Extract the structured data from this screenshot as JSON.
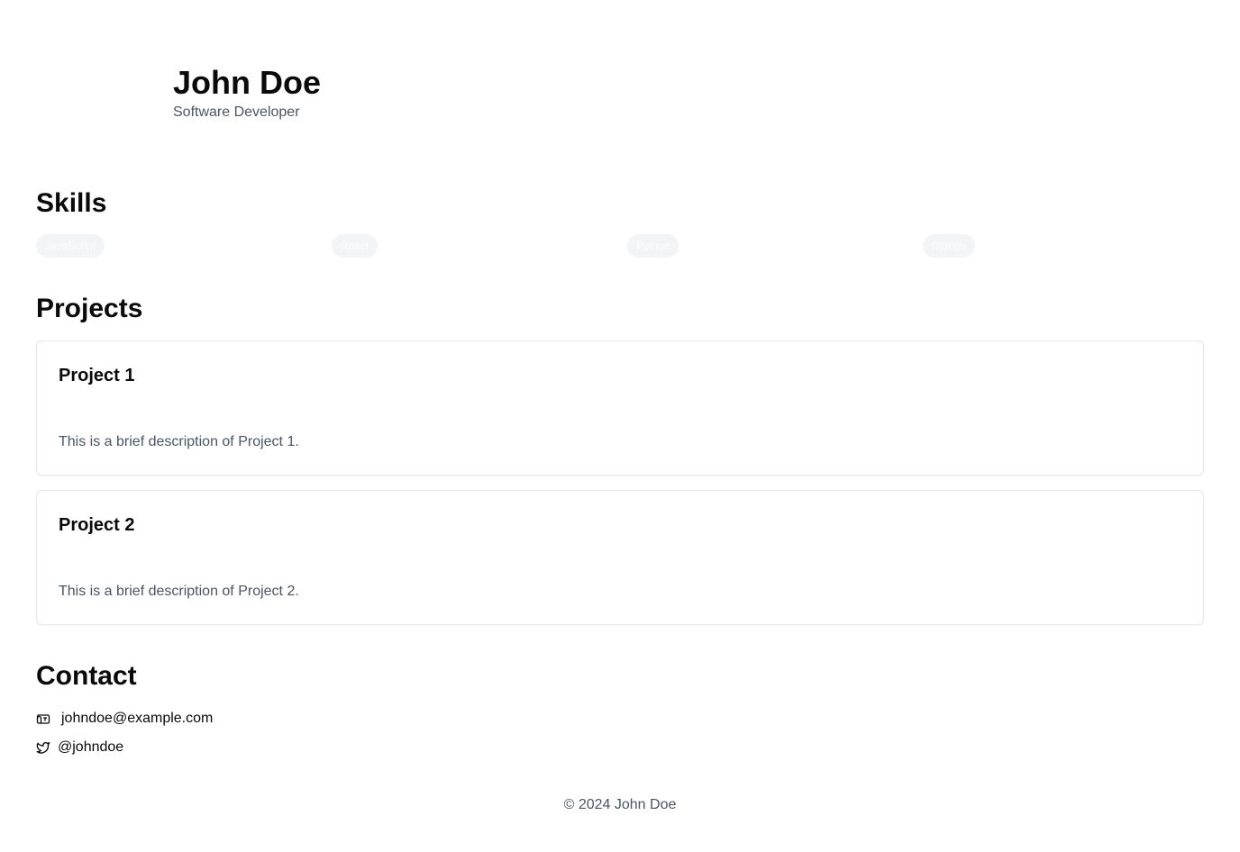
{
  "header": {
    "name": "John Doe",
    "role": "Software Developer"
  },
  "skills": {
    "title": "Skills",
    "items": [
      "JavaScript",
      "React",
      "Python",
      "Django"
    ]
  },
  "projects": {
    "title": "Projects",
    "items": [
      {
        "title": "Project 1",
        "description": "This is a brief description of Project 1."
      },
      {
        "title": "Project 2",
        "description": "This is a brief description of Project 2."
      }
    ]
  },
  "contact": {
    "title": "Contact",
    "email": {
      "icon": "mail-icon",
      "text": "johndoe@example.com"
    },
    "twitter": {
      "icon": "twitter-icon",
      "text": "@johndoe"
    }
  },
  "footer": {
    "text": "© 2024 John Doe"
  }
}
